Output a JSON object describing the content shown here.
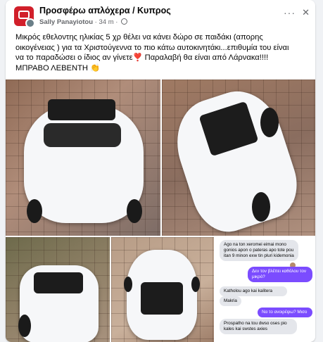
{
  "header": {
    "group_name": "Προσφέρω απλόχερα / Κυπρος",
    "author": "Sally Panayiotou",
    "time": "34 m",
    "more_label": "···",
    "close_label": "✕"
  },
  "post": {
    "text_line1": "Μικρός εθελοντης ηλικίας 5 χρ θέλει να κάνει δώρο σε παιδάκι (απορης",
    "text_line2": "οικογένειας ) για τα Χριστούγεννα το πιο κάτω αυτοκινητάκι...επιθυμία του είναι",
    "text_line3": "να το παραδώσει ο ίδιος αν γίνετε",
    "text_line3_after": " Παραλαβή θα είναι από Λάρνακα!!!!",
    "text_line4": "ΜΠΡΑΒΟ ΛΕΒΕΝΤΗ",
    "heart_emoji": "❣️",
    "clap_emoji": "👏"
  },
  "chat": {
    "messages": [
      {
        "from": "in",
        "text": "Ago na ton xeromei eimai mono gonios apon o pateras apo tote pou itan 9 minon exw tin pluri kidemonia"
      },
      {
        "from": "out",
        "text": "Δεν τον βλέπει καθόλου τον μικρό?"
      },
      {
        "from": "in",
        "text": "Katholou ago kai kalitera"
      },
      {
        "from": "in",
        "text": "Makria"
      },
      {
        "from": "out",
        "text": "Να το ανοιρέψω? Μισο"
      },
      {
        "from": "in",
        "text": "Prospatho na tou dwso oses pio kales kai swstes axies"
      }
    ]
  },
  "colors": {
    "accent": "#7b4cff",
    "avatar_bg": "#d11f2a",
    "heart": "#e41e3f"
  }
}
